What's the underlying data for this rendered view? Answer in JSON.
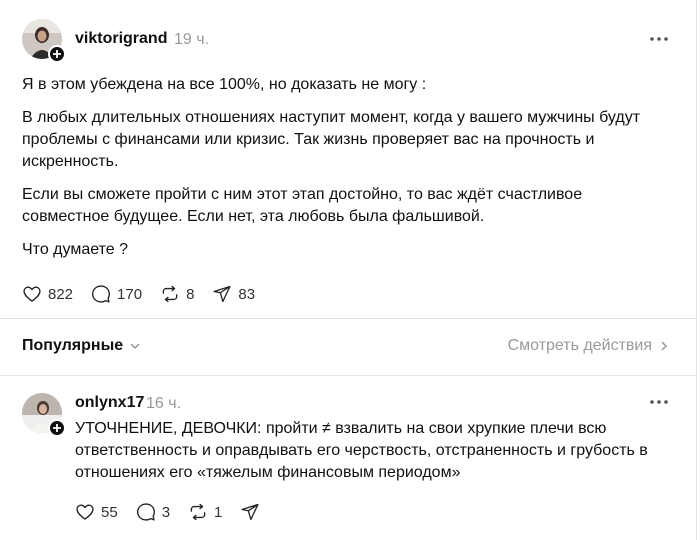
{
  "main_post": {
    "username": "viktorigrand",
    "time": "19 ч.",
    "paragraphs": [
      "Я в этом убеждена на все 100%, но доказать не могу :",
      "В любых длительных отношениях наступит момент, когда у вашего мужчины будут проблемы с финансами или кризис. Так жизнь проверяет вас на прочность и искренность.",
      "Если вы сможете пройти с ним этот этап достойно, то вас ждёт счастливое совместное будущее. Если нет, эта любовь была фальшивой.",
      "Что думаете ?"
    ],
    "likes": "822",
    "replies": "170",
    "reposts": "8",
    "shares": "83"
  },
  "sort_bar": {
    "label": "Популярные",
    "activity_link": "Смотреть действия"
  },
  "reply_post": {
    "username": "onlynx17",
    "time": "16 ч.",
    "text": "УТОЧНЕНИЕ, ДЕВОЧКИ: пройти ≠ взвалить на свои хрупкие плечи всю ответственность и оправдывать его черствость, отстраненность и грубость в отношениях его «тяжелым финансовым периодом»",
    "likes": "55",
    "replies": "3",
    "reposts": "1"
  },
  "colors": {
    "text": "#101010",
    "muted": "#999999",
    "divider": "#e4e4e4"
  }
}
